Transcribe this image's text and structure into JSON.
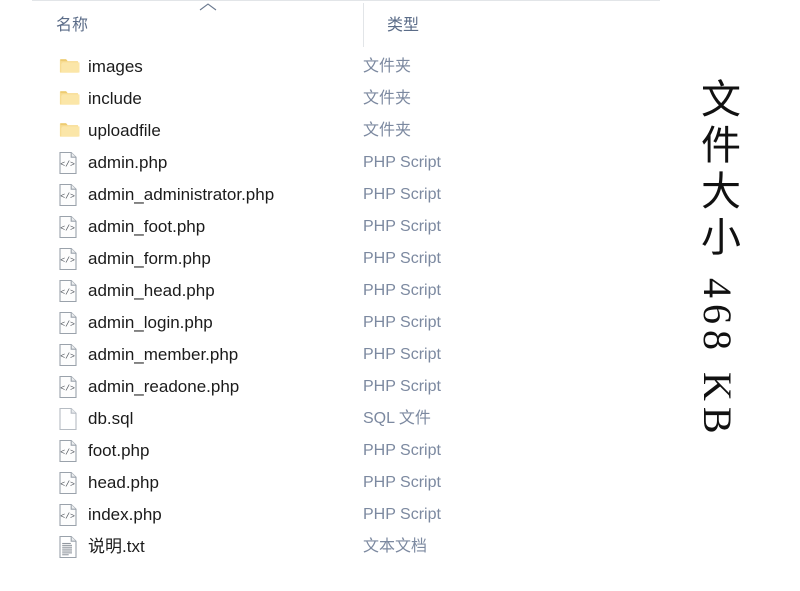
{
  "columns": {
    "name_label": "名称",
    "type_label": "类型",
    "sort_indicator": "chevron-up-icon",
    "sort_direction": "ascending"
  },
  "size_column": {
    "label": "文件大小",
    "value": "468 KB",
    "combined": "文件大小 468 KB"
  },
  "colors": {
    "header_text": "#5b6c88",
    "file_name_text": "#1b1b1b",
    "file_type_text": "#7c89a0",
    "folder_icon": "#f6d98a",
    "divider": "#e2e5e8"
  },
  "files": [
    {
      "name": "images",
      "type": "文件夹",
      "icon": "folder-icon"
    },
    {
      "name": "include",
      "type": "文件夹",
      "icon": "folder-icon"
    },
    {
      "name": "uploadfile",
      "type": "文件夹",
      "icon": "folder-icon"
    },
    {
      "name": "admin.php",
      "type": "PHP Script",
      "icon": "code-file-icon"
    },
    {
      "name": "admin_administrator.php",
      "type": "PHP Script",
      "icon": "code-file-icon"
    },
    {
      "name": "admin_foot.php",
      "type": "PHP Script",
      "icon": "code-file-icon"
    },
    {
      "name": "admin_form.php",
      "type": "PHP Script",
      "icon": "code-file-icon"
    },
    {
      "name": "admin_head.php",
      "type": "PHP Script",
      "icon": "code-file-icon"
    },
    {
      "name": "admin_login.php",
      "type": "PHP Script",
      "icon": "code-file-icon"
    },
    {
      "name": "admin_member.php",
      "type": "PHP Script",
      "icon": "code-file-icon"
    },
    {
      "name": "admin_readone.php",
      "type": "PHP Script",
      "icon": "code-file-icon"
    },
    {
      "name": "db.sql",
      "type": "SQL 文件",
      "icon": "blank-file-icon"
    },
    {
      "name": "foot.php",
      "type": "PHP Script",
      "icon": "code-file-icon"
    },
    {
      "name": "head.php",
      "type": "PHP Script",
      "icon": "code-file-icon"
    },
    {
      "name": "index.php",
      "type": "PHP Script",
      "icon": "code-file-icon"
    },
    {
      "name": "说明.txt",
      "type": "文本文档",
      "icon": "text-file-icon"
    }
  ]
}
